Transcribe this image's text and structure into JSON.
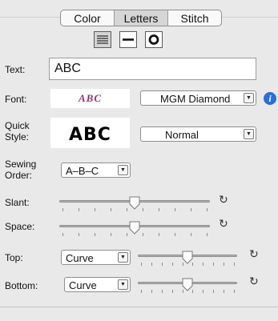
{
  "tabs": [
    "Color",
    "Letters",
    "Stitch"
  ],
  "selected_tab": "Letters",
  "alignment": {
    "selected": "left-align",
    "options": [
      "left-align",
      "single-line",
      "circle"
    ]
  },
  "text": {
    "label": "Text:",
    "value": "ABC"
  },
  "font": {
    "label": "Font:",
    "preview": "ABC",
    "selected": "MGM Diamond",
    "info_icon": "i"
  },
  "quick_style": {
    "label_line1": "Quick",
    "label_line2": "Style:",
    "preview": "ABC",
    "selected": "Normal"
  },
  "sewing_order": {
    "label_line1": "Sewing",
    "label_line2": "Order:",
    "selected": "A–B–C"
  },
  "slant": {
    "label": "Slant:",
    "value": 0.5
  },
  "space": {
    "label": "Space:",
    "value": 0.5
  },
  "top": {
    "label": "Top:",
    "selected": "Curve",
    "slider_value": 0.5
  },
  "bottom": {
    "label": "Bottom:",
    "selected": "Curve",
    "slider_value": 0.5
  },
  "icons": {
    "reset": "reset-arrow-icon",
    "info": "info-icon",
    "dropdown": "dropdown-arrow-icon"
  },
  "colors": {
    "info_blue": "#2a6ed8",
    "panel_bg": "#e9e9e9"
  }
}
